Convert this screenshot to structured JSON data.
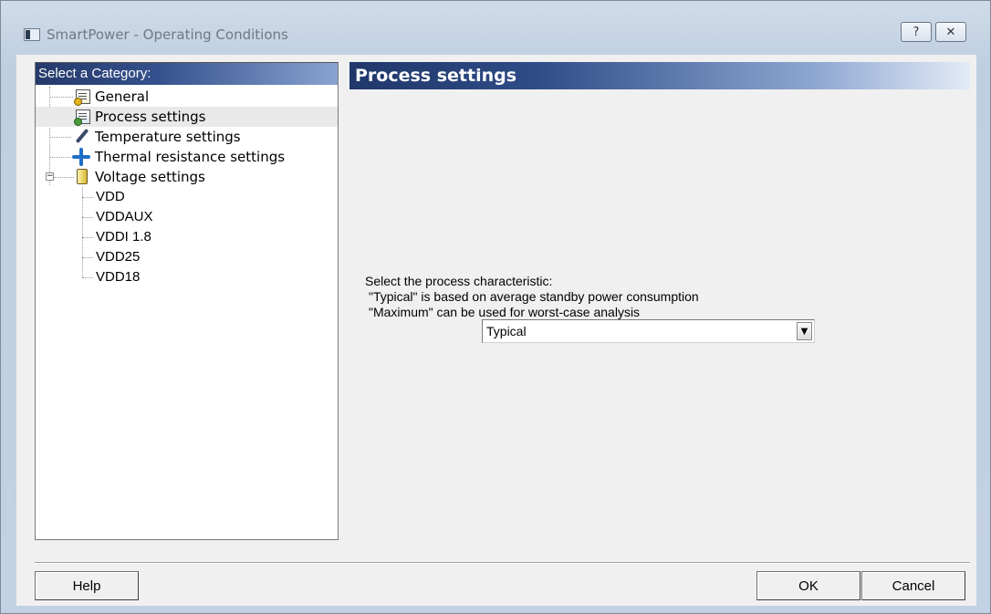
{
  "window": {
    "title": "SmartPower - Operating Conditions",
    "help_glyph": "?",
    "close_glyph": "✕"
  },
  "tree": {
    "header": "Select a Category:",
    "items": [
      {
        "label": "General",
        "icon": "document-gear-icon"
      },
      {
        "label": "Process settings",
        "icon": "document-chip-icon",
        "selected": true
      },
      {
        "label": "Temperature settings",
        "icon": "thermometer-icon"
      },
      {
        "label": "Thermal resistance settings",
        "icon": "fan-icon"
      },
      {
        "label": "Voltage settings",
        "icon": "battery-icon",
        "expanded": true,
        "expander": "−"
      }
    ],
    "voltage_children": [
      "VDD",
      "VDDAUX",
      "VDDI 1.8",
      "VDD25",
      "VDD18"
    ]
  },
  "main": {
    "header": "Process settings",
    "description": [
      "Select the process characteristic:",
      "\"Typical\" is based on average standby power consumption",
      "\"Maximum\" can be used for worst-case analysis"
    ],
    "process_select": {
      "value": "Typical",
      "arrow": "▼"
    }
  },
  "footer": {
    "help_label": "Help",
    "ok_label": "OK",
    "cancel_label": "Cancel"
  },
  "colors": {
    "header_dark": "#20376a",
    "dialog_bg": "#f0f0f0"
  }
}
